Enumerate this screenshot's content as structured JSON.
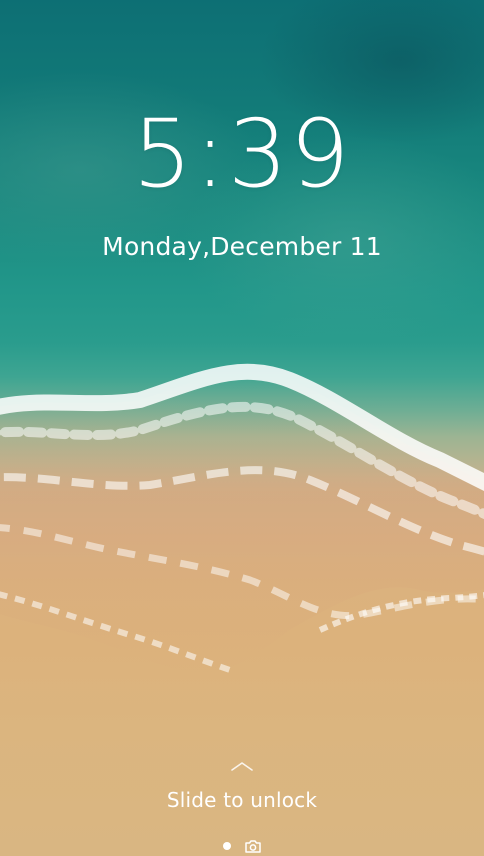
{
  "lockscreen": {
    "time": "5:39",
    "date": "Monday,December 11",
    "unlock_hint": "Slide to unlock"
  },
  "icons": {
    "swipe_up": "chevron-up-icon",
    "page_indicator": "page-dot-icon",
    "camera": "camera-icon"
  },
  "colors": {
    "ocean": "#127a78",
    "sand": "#dbb27e",
    "text": "#ffffff"
  }
}
